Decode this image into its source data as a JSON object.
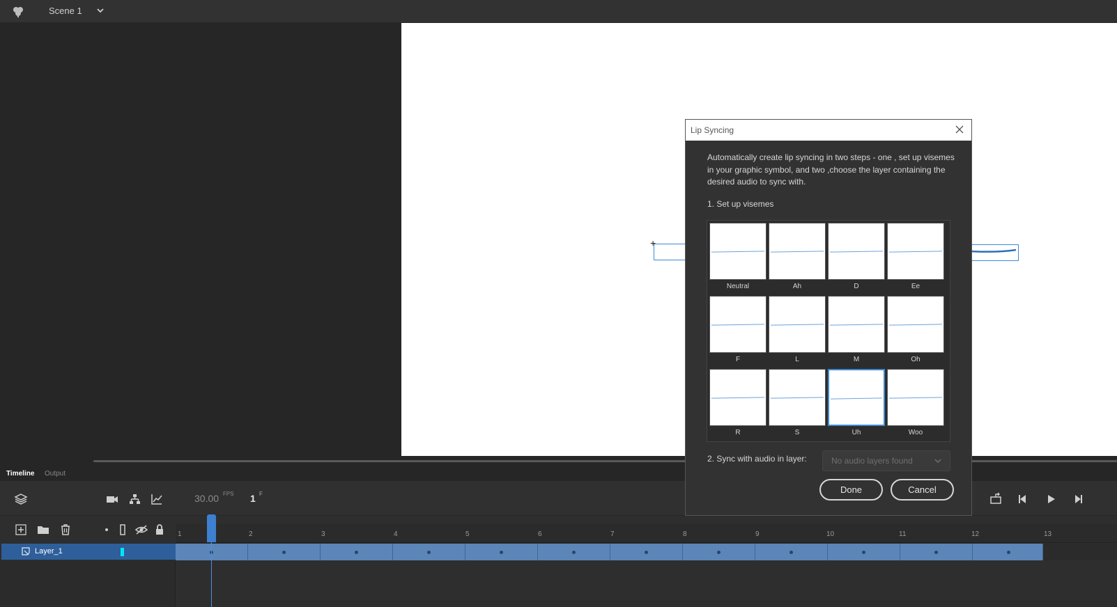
{
  "topbar": {
    "scene_name": "Scene 1"
  },
  "timeline": {
    "tabs": [
      "Timeline",
      "Output"
    ],
    "fps_value": "30.00",
    "fps_unit": "FPS",
    "current_frame": "1",
    "frame_unit": "F",
    "ruler": [
      "1",
      "2",
      "3",
      "4",
      "5",
      "6",
      "7",
      "8",
      "9",
      "10",
      "11",
      "12",
      "13"
    ],
    "layer": {
      "name": "Layer_1",
      "color": "#00e5ff"
    }
  },
  "dialog": {
    "title": "Lip Syncing",
    "description": "Automatically create lip syncing in two steps - one , set up visemes in your graphic symbol, and two ,choose the layer containing the desired audio to sync with.",
    "step1_label": "1. Set up visemes",
    "visemes": [
      "Neutral",
      "Ah",
      "D",
      "Ee",
      "F",
      "L",
      "M",
      "Oh",
      "R",
      "S",
      "Uh",
      "Woo"
    ],
    "selected_viseme": "Uh",
    "step2_label": "2. Sync with audio in layer:",
    "audio_select_value": "No audio layers found",
    "done_label": "Done",
    "cancel_label": "Cancel"
  },
  "colors": {
    "accent": "#3d8ad6",
    "frames_bg": "#5d86b8",
    "layer_selected": "#2e5f9a"
  }
}
